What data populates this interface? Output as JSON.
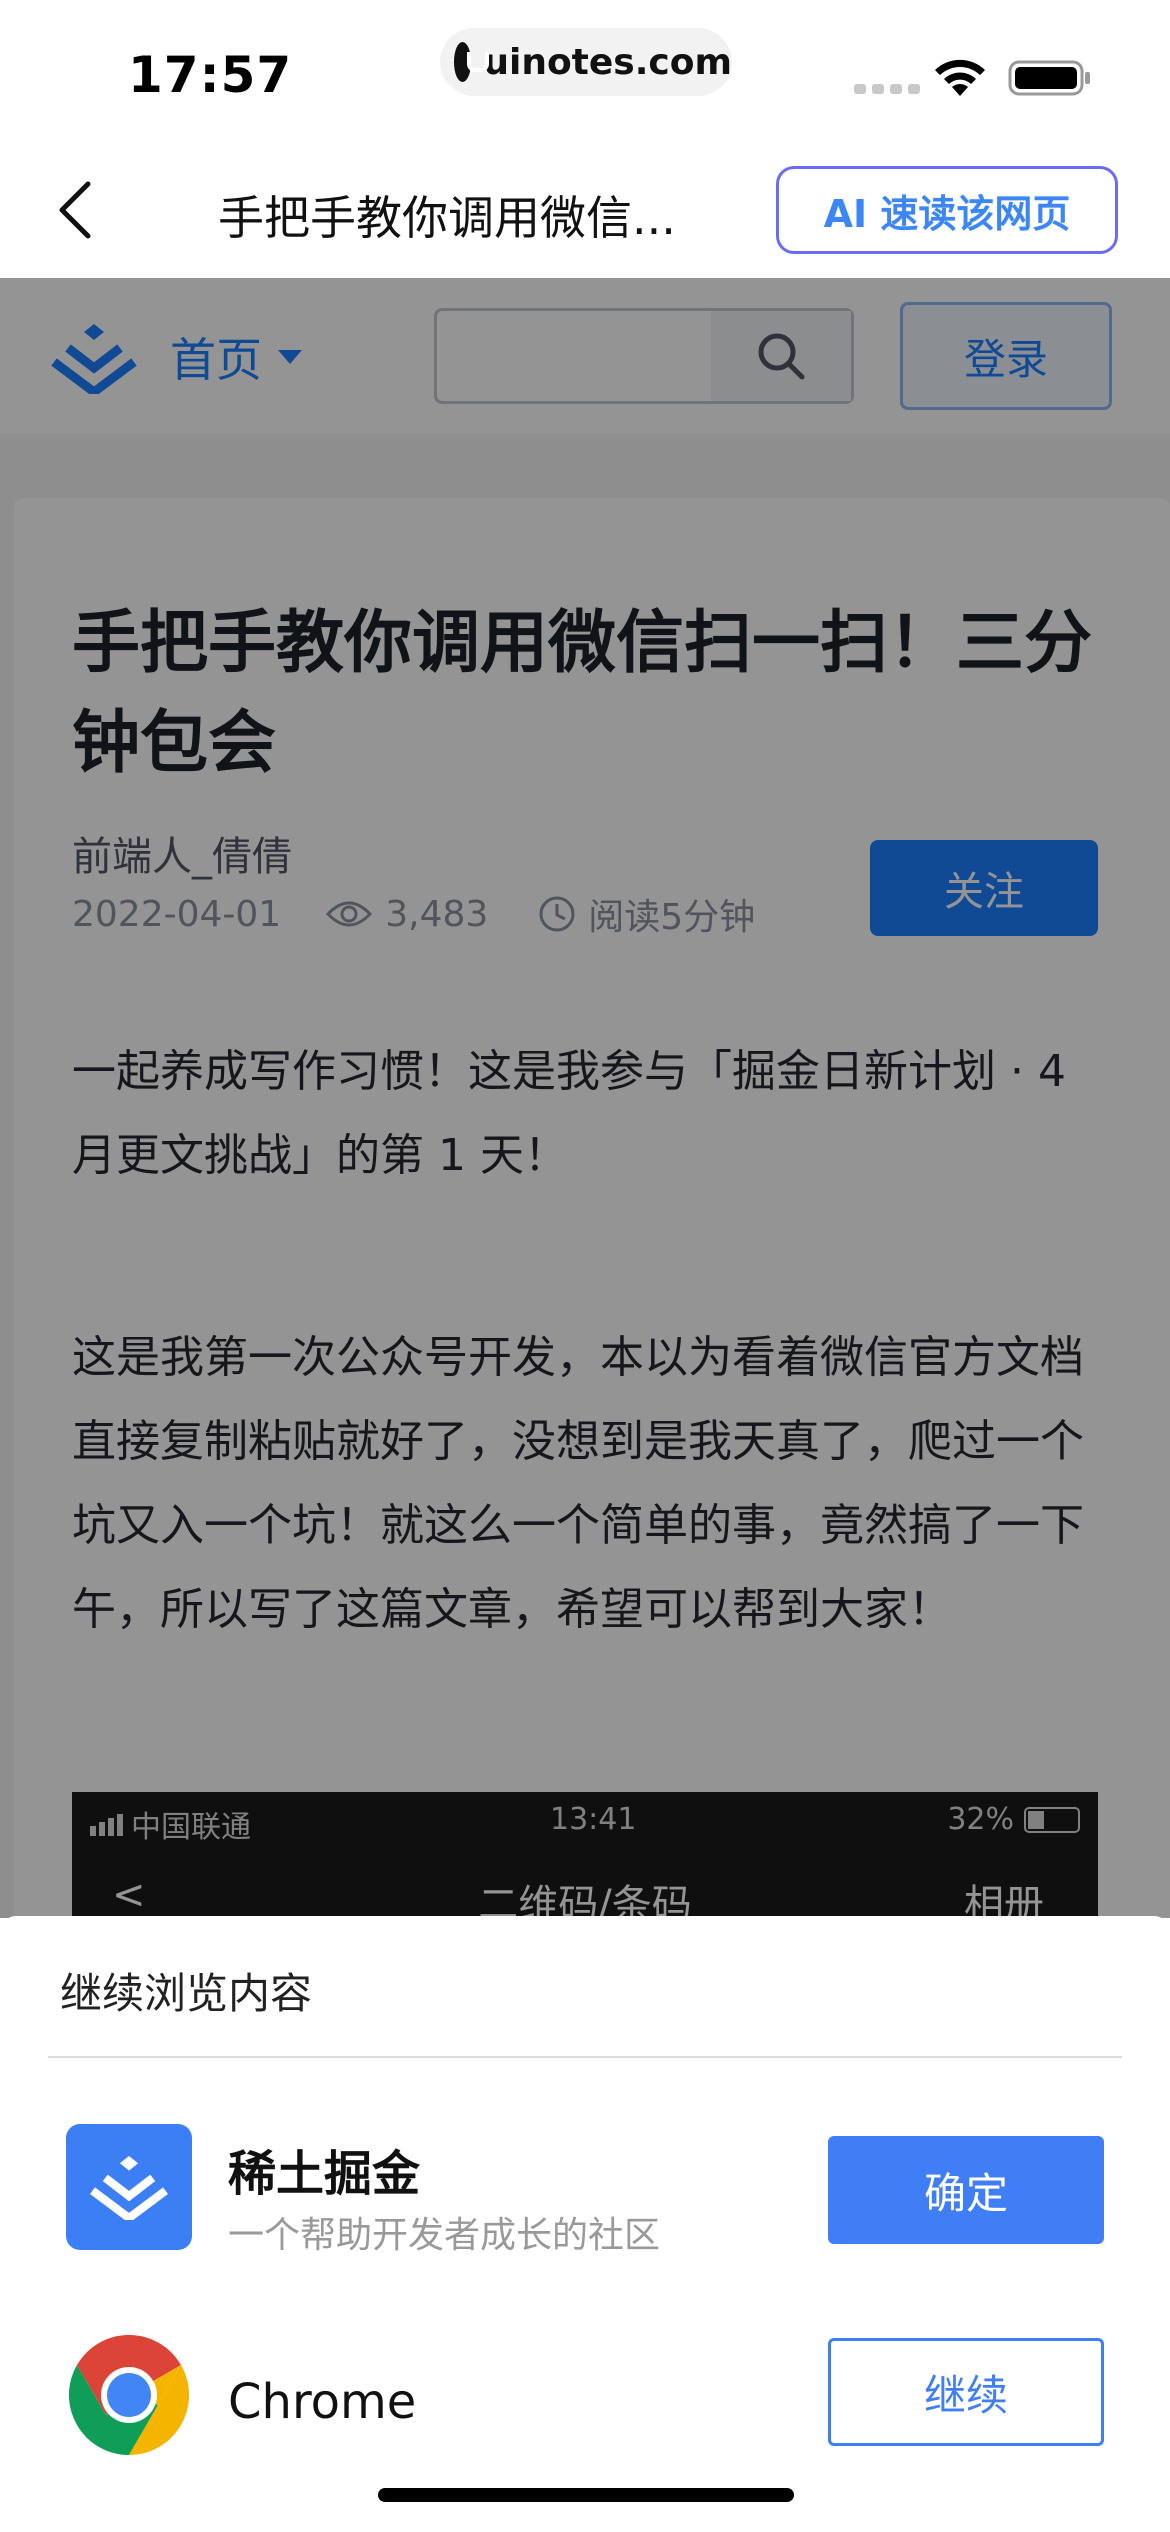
{
  "status_bar": {
    "time": "17:57",
    "url": "uinotes.com"
  },
  "nav": {
    "title": "手把手教你调用微信...",
    "ai_button": "AI 速读该网页"
  },
  "site": {
    "home": "首页",
    "search_placeholder": "",
    "login": "登录"
  },
  "article": {
    "title": "手把手教你调用微信扫一扫！三分钟包会",
    "author": "前端人_倩倩",
    "date": "2022-04-01",
    "views": "3,483",
    "read_time": "阅读5分钟",
    "follow": "关注",
    "para1": "一起养成写作习惯！这是我参与「掘金日新计划 · 4 月更文挑战」的第 1 天！",
    "para2": "这是我第一次公众号开发，本以为看着微信官方文档直接复制粘贴就好了，没想到是我天真了，爬过一个坑又入一个坑！就这么一个简单的事，竟然搞了一下午，所以写了这篇文章，希望可以帮到大家！",
    "screenshot": {
      "carrier": "中国联通",
      "time": "13:41",
      "battery": "32%",
      "back": "<",
      "title": "二维码/条码",
      "album": "相册"
    }
  },
  "sheet": {
    "title": "继续浏览内容",
    "apps": [
      {
        "name": "稀土掘金",
        "desc": "一个帮助开发者成长的社区",
        "action": "确定"
      },
      {
        "name": "Chrome",
        "action": "继续"
      }
    ]
  },
  "colors": {
    "accent": "#3f7ef5",
    "juejin_blue": "#1e80ff",
    "ai_border": "#6b6cf6"
  }
}
